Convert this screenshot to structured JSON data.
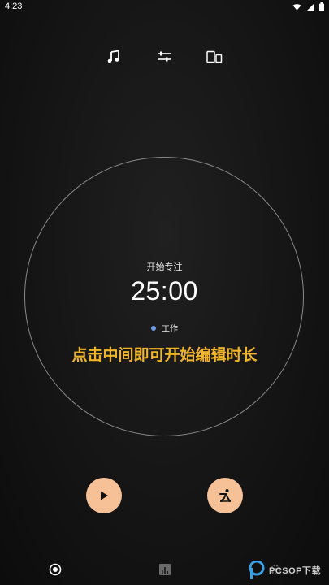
{
  "status": {
    "time": "4:23",
    "icons": [
      "wifi-icon",
      "signal-icon",
      "battery-icon"
    ]
  },
  "toolbar": {
    "icons": [
      "music-note-icon",
      "sliders-icon",
      "devices-icon"
    ]
  },
  "timer": {
    "label": "开始专注",
    "time": "25:00",
    "tag_label": "工作",
    "tag_color": "#6f9ae0",
    "hint": "点击中间即可开始编辑时长"
  },
  "colors": {
    "accent": "#f6c197",
    "hint": "#f0b429",
    "ring": "#8a8a8a"
  },
  "actions": {
    "icons": [
      "play-icon",
      "yoga-icon"
    ]
  },
  "bottom_nav": {
    "icons": [
      "timer-icon",
      "stats-icon",
      "settings-icon"
    ]
  },
  "watermark": {
    "text": "PCSOP下载"
  }
}
